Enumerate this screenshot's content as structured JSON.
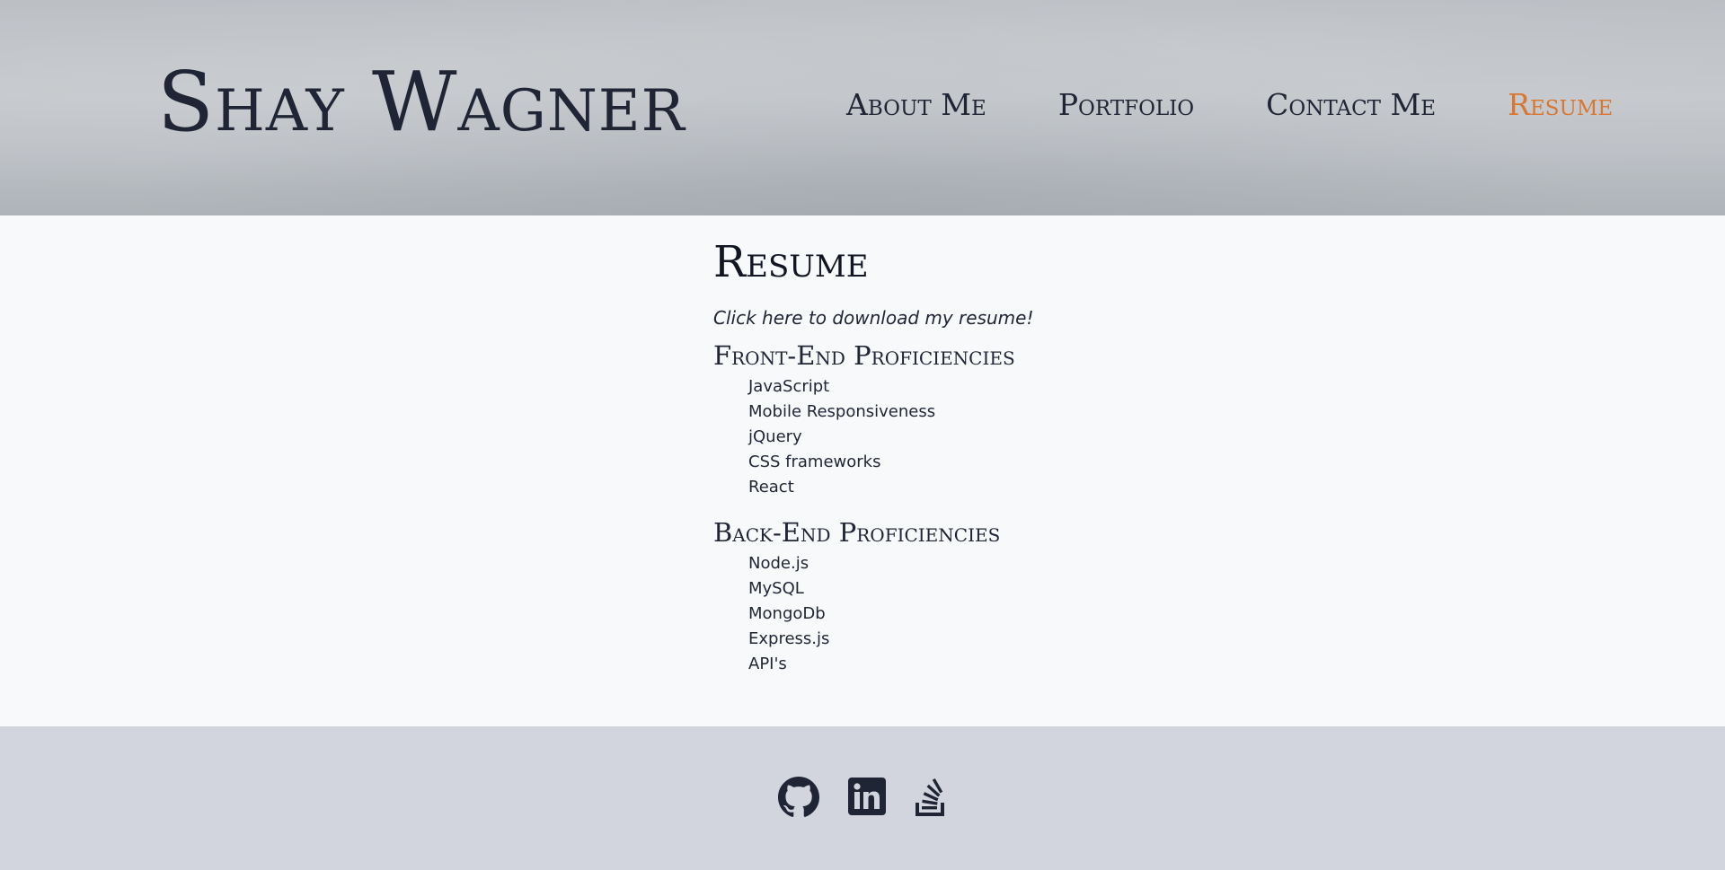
{
  "header": {
    "brand": "Shay Wagner",
    "nav": [
      {
        "label": "About Me"
      },
      {
        "label": "Portfolio"
      },
      {
        "label": "Contact Me"
      },
      {
        "label": "Resume",
        "active": true
      }
    ]
  },
  "main": {
    "title": "Resume",
    "download_link": "Click here to download my resume!",
    "sections": [
      {
        "title": "Front-End Proficiencies",
        "items": [
          "JavaScript",
          "Mobile Responsiveness",
          "jQuery",
          "CSS frameworks",
          "React"
        ]
      },
      {
        "title": "Back-End Proficiencies",
        "items": [
          "Node.js",
          "MySQL",
          "MongoDb",
          "Express.js",
          "API's"
        ]
      }
    ]
  },
  "footer": {
    "icons": [
      "github-icon",
      "linkedin-icon",
      "stack-overflow-icon"
    ]
  },
  "colors": {
    "accent": "#d9762f",
    "text": "#1f2535",
    "footer_bg": "#d2d5dd",
    "body_bg": "#f8f9fb"
  }
}
